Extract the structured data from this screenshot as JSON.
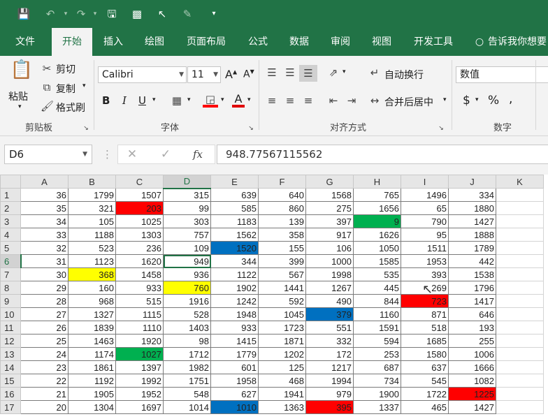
{
  "quick_access": {
    "save": "save-icon",
    "undo": "undo-icon",
    "redo": "redo-icon",
    "save_as": "save-as-icon",
    "select": "select-icon",
    "pointer": "pointer-icon",
    "format": "format-icon",
    "customize": "customize-icon"
  },
  "tabs": [
    "文件",
    "开始",
    "插入",
    "绘图",
    "页面布局",
    "公式",
    "数据",
    "审阅",
    "视图",
    "开发工具",
    "告诉我你想要"
  ],
  "active_tab": "开始",
  "ribbon": {
    "clipboard": {
      "paste": "粘贴",
      "cut": "剪切",
      "copy": "复制",
      "format_painter": "格式刷",
      "label": "剪贴板"
    },
    "font": {
      "name": "Calibri",
      "size": "11",
      "bold": "B",
      "italic": "I",
      "underline": "U",
      "label": "字体",
      "grow": "A",
      "shrink": "A",
      "font_color": "A"
    },
    "alignment": {
      "wrap": "自动换行",
      "merge": "合并后居中",
      "label": "对齐方式"
    },
    "number": {
      "format": "数值",
      "currency": "$",
      "percent": "%",
      "comma": ",",
      "label": "数字"
    }
  },
  "formula_bar": {
    "name_box": "D6",
    "value": "948.77567115562",
    "fx": "fx"
  },
  "columns": [
    "A",
    "B",
    "C",
    "D",
    "E",
    "F",
    "G",
    "H",
    "I",
    "J",
    "K"
  ],
  "rows": [
    [
      "1",
      "36",
      "1799",
      "1507",
      "315",
      "639",
      "640",
      "1568",
      "765",
      "1496",
      "334"
    ],
    [
      "2",
      "35",
      "321",
      "203",
      "99",
      "585",
      "860",
      "275",
      "1656",
      "65",
      "1880"
    ],
    [
      "3",
      "34",
      "105",
      "1025",
      "303",
      "1183",
      "139",
      "397",
      "9",
      "790",
      "1427"
    ],
    [
      "4",
      "33",
      "1188",
      "1303",
      "757",
      "1562",
      "358",
      "917",
      "1626",
      "95",
      "1888"
    ],
    [
      "5",
      "32",
      "523",
      "236",
      "109",
      "1520",
      "155",
      "106",
      "1050",
      "1511",
      "1789"
    ],
    [
      "6",
      "31",
      "1123",
      "1620",
      "949",
      "344",
      "399",
      "1000",
      "1585",
      "1953",
      "442"
    ],
    [
      "7",
      "30",
      "368",
      "1458",
      "936",
      "1122",
      "567",
      "1998",
      "535",
      "393",
      "1538"
    ],
    [
      "8",
      "29",
      "160",
      "933",
      "760",
      "1902",
      "1441",
      "1267",
      "445",
      "269",
      "1796"
    ],
    [
      "9",
      "28",
      "968",
      "515",
      "1916",
      "1242",
      "592",
      "490",
      "844",
      "723",
      "1417"
    ],
    [
      "10",
      "27",
      "1327",
      "1115",
      "528",
      "1948",
      "1045",
      "379",
      "1160",
      "871",
      "646"
    ],
    [
      "11",
      "26",
      "1839",
      "1110",
      "1403",
      "933",
      "1723",
      "551",
      "1591",
      "518",
      "193"
    ],
    [
      "12",
      "25",
      "1463",
      "1920",
      "98",
      "1415",
      "1871",
      "332",
      "594",
      "1685",
      "255"
    ],
    [
      "13",
      "24",
      "1174",
      "1027",
      "1712",
      "1779",
      "1202",
      "172",
      "253",
      "1580",
      "1006"
    ],
    [
      "14",
      "23",
      "1861",
      "1397",
      "1982",
      "601",
      "125",
      "1217",
      "687",
      "637",
      "1666"
    ],
    [
      "15",
      "22",
      "1192",
      "1992",
      "1751",
      "1958",
      "468",
      "1994",
      "734",
      "545",
      "1082"
    ],
    [
      "16",
      "21",
      "1905",
      "1952",
      "548",
      "627",
      "1941",
      "979",
      "1900",
      "1722",
      "1225"
    ],
    [
      "17",
      "20",
      "1304",
      "1697",
      "1014",
      "1010",
      "1363",
      "395",
      "1337",
      "465",
      "1427"
    ]
  ],
  "highlights": [
    {
      "row": 2,
      "col": "C",
      "color": "#ff0000"
    },
    {
      "row": 3,
      "col": "H",
      "color": "#00b050"
    },
    {
      "row": 5,
      "col": "E",
      "color": "#0070c0"
    },
    {
      "row": 7,
      "col": "B",
      "color": "#ffff00"
    },
    {
      "row": 8,
      "col": "D",
      "color": "#ffff00"
    },
    {
      "row": 9,
      "col": "I",
      "color": "#ff0000"
    },
    {
      "row": 10,
      "col": "G",
      "color": "#0070c0"
    },
    {
      "row": 13,
      "col": "C",
      "color": "#00b050"
    },
    {
      "row": 16,
      "col": "J",
      "color": "#ff0000"
    },
    {
      "row": 17,
      "col": "E",
      "color": "#0070c0"
    },
    {
      "row": 17,
      "col": "G",
      "color": "#ff0000"
    }
  ],
  "active_cell": {
    "row": 6,
    "col": "D"
  },
  "colors": {
    "accent": "#217346",
    "ribbon_bg": "#f3f3f3"
  }
}
